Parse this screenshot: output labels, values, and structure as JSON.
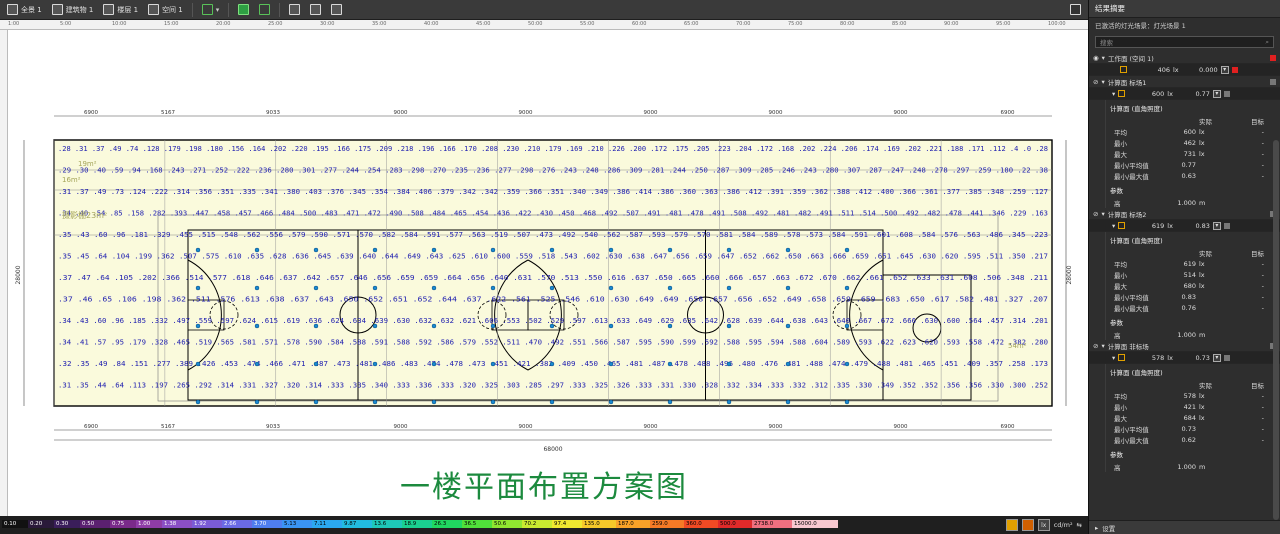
{
  "toolbar": {
    "items": [
      {
        "label": "全景 1",
        "icon": "scene-icon"
      },
      {
        "label": "建筑物 1",
        "icon": "building-icon"
      },
      {
        "label": "楼层 1",
        "icon": "floor-icon"
      },
      {
        "label": "空间 1",
        "icon": "room-icon"
      }
    ]
  },
  "ruler": {
    "ticks": [
      "1:00",
      "5:00",
      "10:00",
      "15:00",
      "20:00",
      "25:00",
      "30:00",
      "35:00",
      "40:00",
      "45:00",
      "50:00",
      "55:00",
      "60:00",
      "65:00",
      "70:00",
      "75:00",
      "80:00",
      "85:00",
      "90:00",
      "95:00",
      "100:00"
    ]
  },
  "plan": {
    "title": "一楼平面布置方案图",
    "top_dims": [
      "6900",
      "5167",
      "9033",
      "9000",
      "9000",
      "9000",
      "9000",
      "9000",
      "6900"
    ],
    "bottom_dims": [
      "6900",
      "5167",
      "9033",
      "9000",
      "9000",
      "9000",
      "9000",
      "9000",
      "6900"
    ],
    "total_dim": "68000",
    "left_dims": [
      "6300",
      "5500",
      "6850",
      "6300"
    ],
    "left_total": "28000",
    "right_total": "28000",
    "room_labels": [
      "摄影棚23m²",
      "16m²",
      "19m²",
      "54m²"
    ],
    "sample_values": [
      ".28 .31 .37 .49 .74 .128 .179 .198 .180 .156 .164 .202 .220 .195 .166 .175 .209 .218 .196 .166 .170 .208 .230 .210 .179 .169 .210 .226 .200 .172 .175 .205 .223 .204 .172 .168 .202 .224 .206 .174 .169 .202 .221 .188 .171 .112 .4 .0 .28",
      ".29 .30 .40 .59 .94 .168 .243 .271 .252 .222 .236 .280 .301 .277 .244 .254 .283 .298 .270 .235 .236 .277 .298 .276 .243 .248 .286 .309 .281 .244 .250 .287 .309 .285 .246 .243 .280 .307 .287 .247 .248 .278 .297 .259 .180 .22 .38",
      ".31 .37 .49 .73 .124 .222 .314 .356 .351 .335 .341 .380 .403 .376 .345 .354 .384 .406 .379 .342 .342 .359 .366 .351 .340 .349 .386 .414 .386 .360 .363 .386 .412 .391 .359 .362 .388 .412 .400 .366 .361 .377 .385 .348 .259 .127",
      ".34 .40 .54 .85 .158 .282 .393 .447 .458 .457 .466 .484 .500 .483 .471 .472 .490 .508 .484 .465 .454 .436 .422 .430 .450 .468 .492 .507 .491 .481 .478 .491 .508 .492 .481 .482 .491 .511 .514 .500 .492 .482 .478 .441 .346 .229 .163",
      ".35 .43 .60 .96 .181 .329 .455 .515 .548 .562 .556 .579 .590 .571 .570 .582 .584 .591 .577 .563 .519 .507 .473 .492 .540 .562 .587 .593 .579 .570 .581 .584 .589 .578 .573 .584 .591 .601 .608 .584 .576 .563 .486 .345 .223",
      ".35 .45 .64 .104 .199 .362 .507 .575 .610 .635 .628 .636 .645 .639 .640 .644 .649 .643 .625 .610 .600 .559 .518 .543 .602 .630 .638 .647 .656 .659 .647 .652 .662 .650 .663 .666 .659 .651 .645 .630 .620 .595 .511 .350 .217",
      ".37 .47 .64 .105 .202 .366 .514 .577 .618 .646 .637 .642 .657 .646 .656 .659 .659 .664 .656 .640 .631 .570 .513 .550 .616 .637 .650 .665 .660 .666 .657 .663 .672 .670 .662 .661 .652 .633 .631 .608 .506 .348 .211",
      ".37 .46 .65 .106 .198 .362 .511 .576 .613 .638 .637 .643 .650 .652 .651 .652 .644 .637 .622 .561 .525 .546 .610 .630 .649 .649 .658 .657 .656 .652 .649 .658 .659 .659 .683 .650 .617 .582 .481 .327 .207",
      ".34 .43 .60 .96 .185 .332 .497 .559 .597 .624 .615 .619 .636 .624 .634 .639 .630 .632 .632 .621 .606 .553 .502 .529 .597 .613 .633 .649 .629 .635 .642 .628 .639 .644 .638 .643 .640 .667 .672 .666 .630 .600 .564 .457 .314 .201",
      ".34 .41 .57 .95 .179 .328 .465 .519 .565 .581 .571 .578 .590 .584 .588 .591 .588 .592 .586 .579 .552 .511 .470 .492 .551 .566 .587 .595 .590 .599 .592 .588 .595 .594 .588 .604 .589 .593 .622 .623 .620 .593 .558 .472 .382 .280",
      ".32 .35 .49 .84 .151 .277 .389 .426 .453 .474 .466 .471 .487 .473 .481 .486 .483 .474 .478 .473 .451 .421 .382 .409 .450 .465 .481 .487 .478 .488 .496 .480 .476 .481 .488 .474 .479 .488 .481 .465 .451 .409 .357 .258 .173",
      ".31 .35 .44 .64 .113 .197 .265 .292 .314 .331 .327 .320 .314 .333 .335 .340 .333 .336 .333 .320 .325 .303 .285 .297 .333 .325 .326 .333 .331 .330 .328 .332 .334 .333 .332 .312 .335 .330 .349 .352 .352 .356 .356 .330 .300 .252"
    ]
  },
  "legend": {
    "segments": [
      {
        "label": "0.10",
        "color": "#111111"
      },
      {
        "label": "0.20",
        "color": "#2a1a3a"
      },
      {
        "label": "0.30",
        "color": "#3a1e5a"
      },
      {
        "label": "0.50",
        "color": "#5b2070"
      },
      {
        "label": "0.75",
        "color": "#7a2a8a"
      },
      {
        "label": "1.00",
        "color": "#8e3ca6"
      },
      {
        "label": "1.38",
        "color": "#8a4fc4"
      },
      {
        "label": "1.92",
        "color": "#7a5cd6"
      },
      {
        "label": "2.66",
        "color": "#6a6ae4"
      },
      {
        "label": "3.70",
        "color": "#4f7ef0"
      },
      {
        "label": "5.13",
        "color": "#3a94f4"
      },
      {
        "label": "7.11",
        "color": "#2ba8f0"
      },
      {
        "label": "9.87",
        "color": "#22bce0"
      },
      {
        "label": "13.6",
        "color": "#1ec8b8"
      },
      {
        "label": "18.9",
        "color": "#1ad090"
      },
      {
        "label": "26.3",
        "color": "#20d860"
      },
      {
        "label": "36.5",
        "color": "#50e03a"
      },
      {
        "label": "50.6",
        "color": "#90e630"
      },
      {
        "label": "70.2",
        "color": "#c8ea30"
      },
      {
        "label": "97.4",
        "color": "#efe830"
      },
      {
        "label": "135.0",
        "color": "#f6c82a"
      },
      {
        "label": "187.0",
        "color": "#f8a228"
      },
      {
        "label": "259.0",
        "color": "#f67a26"
      },
      {
        "label": "360.0",
        "color": "#f04a24"
      },
      {
        "label": "500.0",
        "color": "#e02a2a"
      },
      {
        "label": "2738.0",
        "color": "#f07080"
      },
      {
        "label": "15000.0",
        "color": "#f8c8d0"
      }
    ],
    "unit_lx": "lx",
    "unit_cd": "cd/m²"
  },
  "panel": {
    "title": "结果摘要",
    "subtitle": "已激活的灯光场景：灯光场景 1",
    "search_placeholder": "搜索",
    "workplane": {
      "label": "工作面 (空间 1)",
      "value": "406",
      "unit": "lx",
      "ratio": "0.000"
    },
    "cards": [
      {
        "name": "计算面 标场1",
        "value": "600",
        "unit": "lx",
        "ratio": "0.77",
        "type": "计算面 (直角照度)",
        "header_actual": "实际",
        "header_target": "目标",
        "rows": [
          {
            "k": "平均",
            "v": "600",
            "u": "lx",
            "t": "-"
          },
          {
            "k": "最小",
            "v": "462",
            "u": "lx",
            "t": "-"
          },
          {
            "k": "最大",
            "v": "731",
            "u": "lx",
            "t": "-"
          },
          {
            "k": "最小/平均值",
            "v": "0.77",
            "u": "",
            "t": "-"
          },
          {
            "k": "最小/最大值",
            "v": "0.63",
            "u": "",
            "t": "-"
          }
        ],
        "param_title": "参数",
        "param_k": "高",
        "param_v": "1.000",
        "param_u": "m"
      },
      {
        "name": "计算面 标场2",
        "value": "619",
        "unit": "lx",
        "ratio": "0.83",
        "type": "计算面 (直角照度)",
        "header_actual": "实际",
        "header_target": "目标",
        "rows": [
          {
            "k": "平均",
            "v": "619",
            "u": "lx",
            "t": "-"
          },
          {
            "k": "最小",
            "v": "514",
            "u": "lx",
            "t": "-"
          },
          {
            "k": "最大",
            "v": "680",
            "u": "lx",
            "t": "-"
          },
          {
            "k": "最小/平均值",
            "v": "0.83",
            "u": "",
            "t": "-"
          },
          {
            "k": "最小/最大值",
            "v": "0.76",
            "u": "",
            "t": "-"
          }
        ],
        "param_title": "参数",
        "param_k": "高",
        "param_v": "1.000",
        "param_u": "m"
      },
      {
        "name": "计算面 非标场",
        "value": "578",
        "unit": "lx",
        "ratio": "0.73",
        "type": "计算面 (直角照度)",
        "header_actual": "实际",
        "header_target": "目标",
        "rows": [
          {
            "k": "平均",
            "v": "578",
            "u": "lx",
            "t": "-"
          },
          {
            "k": "最小",
            "v": "421",
            "u": "lx",
            "t": "-"
          },
          {
            "k": "最大",
            "v": "684",
            "u": "lx",
            "t": "-"
          },
          {
            "k": "最小/平均值",
            "v": "0.73",
            "u": "",
            "t": "-"
          },
          {
            "k": "最小/最大值",
            "v": "0.62",
            "u": "",
            "t": "-"
          }
        ],
        "param_title": "参数",
        "param_k": "高",
        "param_v": "1.000",
        "param_u": "m"
      }
    ],
    "footer": "设置"
  }
}
